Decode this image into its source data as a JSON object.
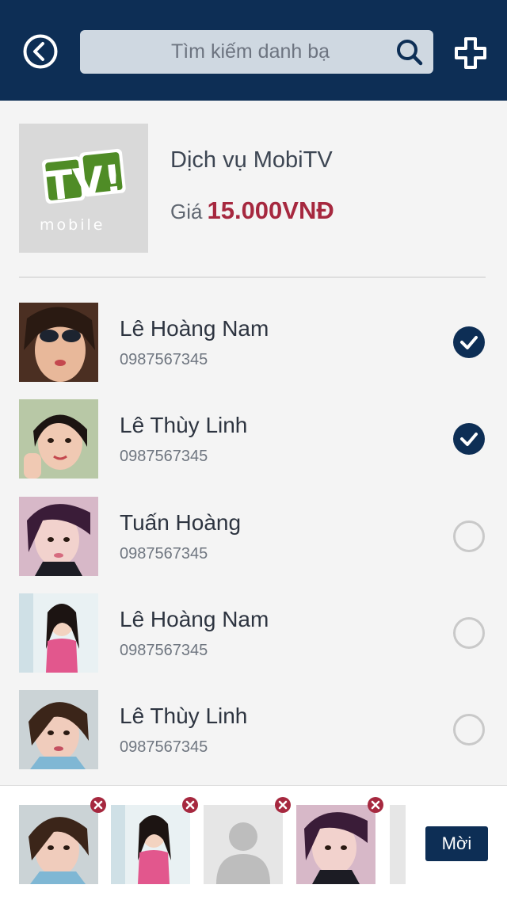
{
  "header": {
    "search_placeholder": "Tìm kiếm danh bạ"
  },
  "service": {
    "name": "Dịch vụ MobiTV",
    "price_label": "Giá",
    "price_value": "15.000VNĐ",
    "logo_text": "TV!",
    "logo_subtext": "mobile"
  },
  "contacts": [
    {
      "name": "Lê Hoàng Nam",
      "phone": "0987567345",
      "selected": true
    },
    {
      "name": "Lê Thùy Linh",
      "phone": "0987567345",
      "selected": true
    },
    {
      "name": "Tuấn Hoàng",
      "phone": "0987567345",
      "selected": false
    },
    {
      "name": "Lê Hoàng Nam",
      "phone": "0987567345",
      "selected": false
    },
    {
      "name": "Lê Thùy Linh",
      "phone": "0987567345",
      "selected": false
    }
  ],
  "bottom": {
    "invite_label": "Mời"
  },
  "colors": {
    "header_bg": "#0d2e55",
    "accent_price": "#a6283f",
    "check_on": "#0d2e55"
  }
}
